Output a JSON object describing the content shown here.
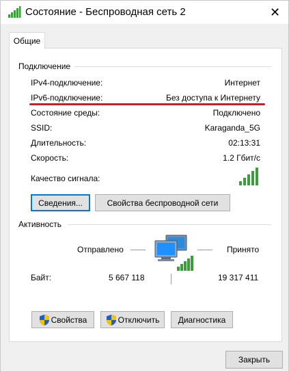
{
  "window": {
    "title": "Состояние - Беспроводная сеть 2",
    "close_glyph": "✕"
  },
  "tabs": [
    {
      "label": "Общие"
    }
  ],
  "connection": {
    "group_title": "Подключение",
    "rows": [
      {
        "label": "IPv4-подключение:",
        "value": "Интернет"
      },
      {
        "label": "IPv6-подключение:",
        "value": "Без доступа к Интернету"
      },
      {
        "label": "Состояние среды:",
        "value": "Подключено"
      },
      {
        "label": "SSID:",
        "value": "Karaganda_5G"
      },
      {
        "label": "Длительность:",
        "value": "02:13:31"
      },
      {
        "label": "Скорость:",
        "value": "1.2 Гбит/с"
      }
    ],
    "signal_label": "Качество сигнала:",
    "signal_bars": 5,
    "signal_level": 5,
    "details_button": "Сведения...",
    "wireless_props_button": "Свойства беспроводной сети",
    "highlight_color": "#e0141e"
  },
  "activity": {
    "group_title": "Активность",
    "sent_label": "Отправлено",
    "received_label": "Принято",
    "bytes_label": "Байт:",
    "bytes_sent": "5 667 118",
    "bytes_received": "19 317 411"
  },
  "buttons": {
    "properties": "Свойства",
    "disable": "Отключить",
    "diagnose": "Диагностика",
    "close": "Закрыть"
  },
  "colors": {
    "signal_green": "#3a9e3a",
    "focus_blue": "#0078d7"
  },
  "icons": {
    "title": "wireless-signal-icon",
    "network": "network-computers-icon",
    "shield": "uac-shield-icon"
  }
}
